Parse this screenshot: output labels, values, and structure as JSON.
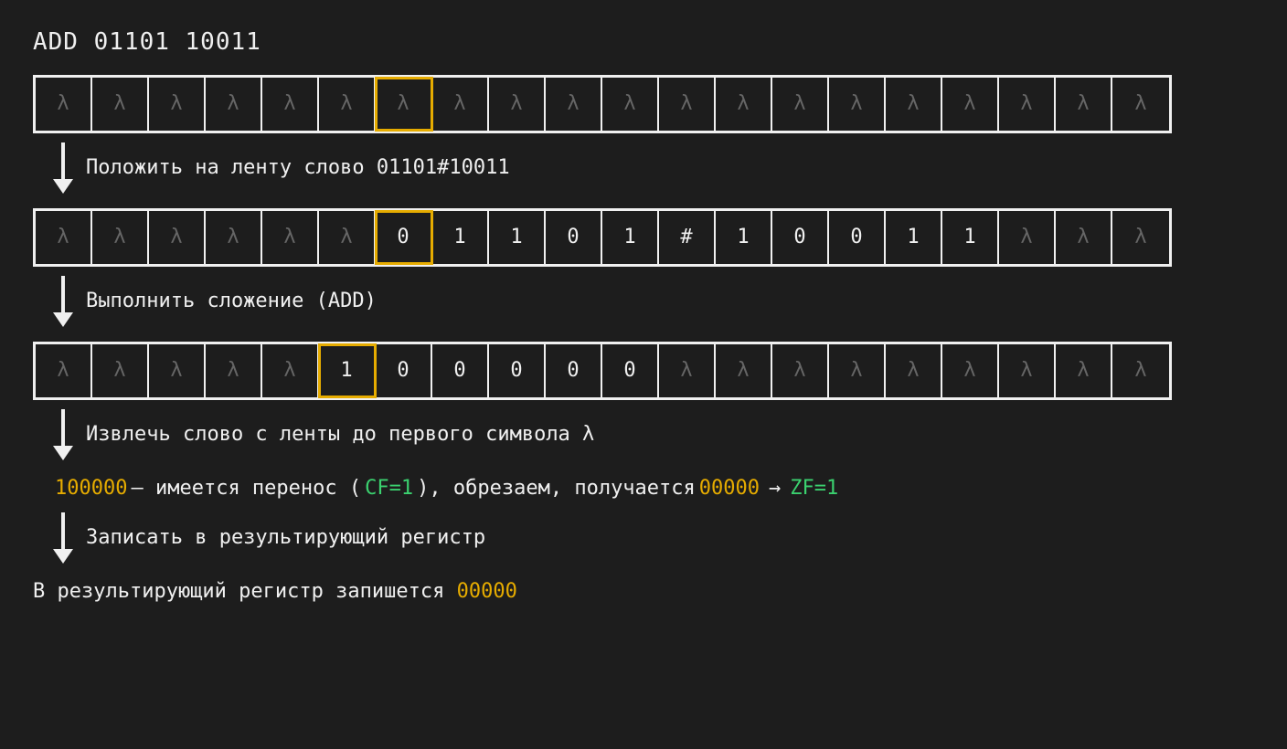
{
  "title": "ADD 01101 10011",
  "lambda": "λ",
  "tapes": [
    {
      "head_index": 6,
      "cells": [
        "λ",
        "λ",
        "λ",
        "λ",
        "λ",
        "λ",
        "λ",
        "λ",
        "λ",
        "λ",
        "λ",
        "λ",
        "λ",
        "λ",
        "λ",
        "λ",
        "λ",
        "λ",
        "λ",
        "λ"
      ]
    },
    {
      "head_index": 6,
      "cells": [
        "λ",
        "λ",
        "λ",
        "λ",
        "λ",
        "λ",
        "0",
        "1",
        "1",
        "0",
        "1",
        "#",
        "1",
        "0",
        "0",
        "1",
        "1",
        "λ",
        "λ",
        "λ"
      ]
    },
    {
      "head_index": 5,
      "cells": [
        "λ",
        "λ",
        "λ",
        "λ",
        "λ",
        "1",
        "0",
        "0",
        "0",
        "0",
        "0",
        "λ",
        "λ",
        "λ",
        "λ",
        "λ",
        "λ",
        "λ",
        "λ",
        "λ"
      ]
    }
  ],
  "steps": [
    "Положить на ленту слово 01101#10011",
    "Выполнить сложение (ADD)",
    "Извлечь слово с ленты до первого символа λ",
    "Записать в результирующий регистр"
  ],
  "result": {
    "raw_word": "100000",
    "middle_a": " — имеется перенос (",
    "cf_flag": "CF=1",
    "middle_b": "), обрезаем, получается ",
    "trimmed": "00000",
    "arrow": "→",
    "zf_flag": "ZF=1"
  },
  "final": {
    "prefix": "В результирующий регистр запишется ",
    "value": "00000"
  }
}
